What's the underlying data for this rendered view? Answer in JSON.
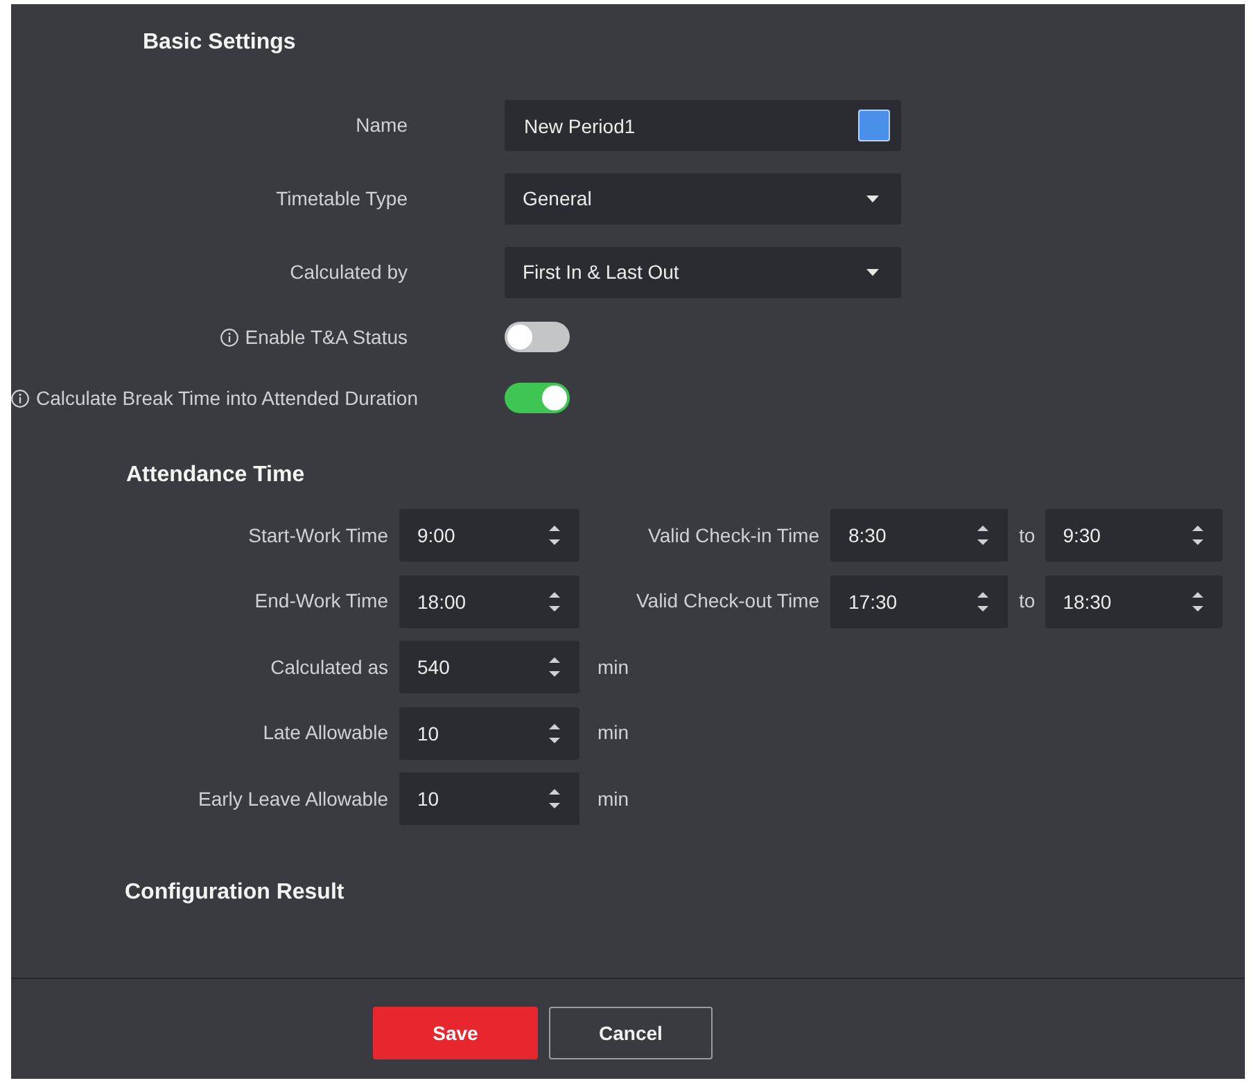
{
  "basic_settings": {
    "title": "Basic Settings",
    "fields": [
      {
        "kind": "text",
        "label": "Name",
        "info": false,
        "value": "New Period1",
        "color": "#4a8fea"
      },
      {
        "kind": "select",
        "label": "Timetable Type",
        "info": false,
        "value": "General"
      },
      {
        "kind": "select",
        "label": "Calculated by",
        "info": false,
        "value": "First In & Last Out"
      },
      {
        "kind": "toggle",
        "label": "Enable T&A Status",
        "info": true,
        "on": false
      },
      {
        "kind": "toggle",
        "label": "Calculate Break Time into Attended Duration",
        "info": true,
        "on": true
      }
    ]
  },
  "attendance_time": {
    "title": "Attendance Time",
    "rows": [
      {
        "label": "Start-Work Time",
        "value": "9:00",
        "range": {
          "label": "Valid Check-in Time",
          "from": "8:30",
          "separator": "to",
          "to": "9:30"
        }
      },
      {
        "label": "End-Work Time",
        "value": "18:00",
        "range": {
          "label": "Valid Check-out Time",
          "from": "17:30",
          "separator": "to",
          "to": "18:30"
        }
      },
      {
        "label": "Calculated as",
        "value": "540",
        "unit": "min"
      },
      {
        "label": "Late Allowable",
        "value": "10",
        "unit": "min"
      },
      {
        "label": "Early Leave Allowable",
        "value": "10",
        "unit": "min"
      }
    ]
  },
  "configuration_result": {
    "title": "Configuration Result"
  },
  "footer": {
    "buttons": [
      {
        "label": "Save",
        "kind": "primary"
      },
      {
        "label": "Cancel",
        "kind": "secondary"
      }
    ]
  }
}
